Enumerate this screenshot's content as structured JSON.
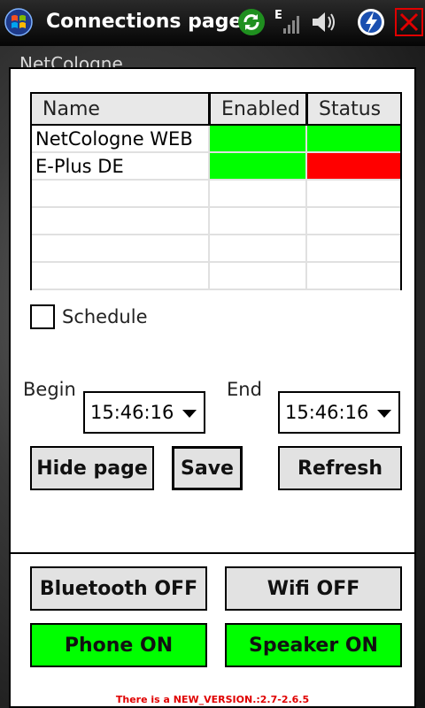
{
  "titlebar": {
    "title": "Connections page",
    "icons": [
      "windows-start-icon",
      "refresh-icon",
      "signal-edge-icon",
      "volume-icon",
      "flash-icon",
      "close-icon"
    ],
    "close_color": "#e00000"
  },
  "background": {
    "partial_text": "NetCologne"
  },
  "grid": {
    "columns": [
      "Name",
      "Enabled",
      "Status"
    ],
    "rows": [
      {
        "name": "NetCologne WEB",
        "enabled_color": "#00ff00",
        "status_color": "#00ff00"
      },
      {
        "name": "E-Plus DE",
        "enabled_color": "#00ff00",
        "status_color": "#ff0000"
      },
      {
        "name": "",
        "enabled_color": "",
        "status_color": ""
      },
      {
        "name": "",
        "enabled_color": "",
        "status_color": ""
      },
      {
        "name": "",
        "enabled_color": "",
        "status_color": ""
      },
      {
        "name": "",
        "enabled_color": "",
        "status_color": ""
      }
    ]
  },
  "schedule": {
    "label": "Schedule",
    "checked": false
  },
  "begin": {
    "label": "Begin",
    "value": "15:46:16"
  },
  "end": {
    "label": "End",
    "value": "15:46:16"
  },
  "buttons": {
    "hide_page": "Hide page",
    "save": "Save",
    "refresh": "Refresh",
    "bluetooth": "Bluetooth OFF",
    "wifi": "Wifi OFF",
    "phone": "Phone ON",
    "speaker": "Speaker ON"
  },
  "colors": {
    "on_green": "#00ff00",
    "status_red": "#ff0000",
    "version_red": "#e00000"
  },
  "version_text": "There is a NEW_VERSION.:2.7-2.6.5"
}
